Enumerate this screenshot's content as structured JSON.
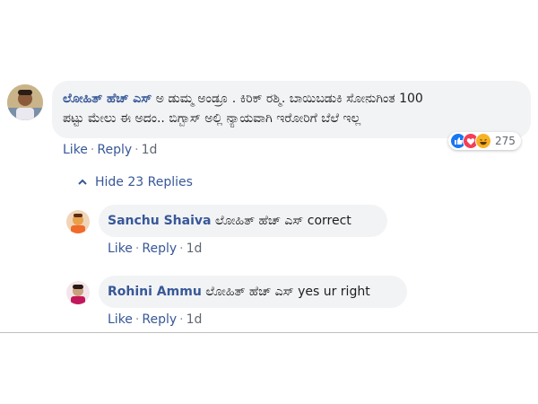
{
  "comments": [
    {
      "author": "ಲೋಹಿತ್ ಹೆಚ್ ಎಸ್",
      "text_line1": "ಅ ಡುಮ್ಮ ಅಂಡ್ರೂ . ಕಿರಿಕ್ ರಶ್ಮಿ. ಬಾಯಿಬಡುಕಿ ಸೋನುಗಿಂತ 100",
      "text_line2": "ಪಟ್ಟು ಮೇಲು ಈ ಅದಂ.. ಬಿಗ್ಬಾಸ್ ಅಲ್ಲಿ ನ್ಯಾಯವಾಗಿ ಇರೋರಿಗೆ ಬೆಲೆ ಇಲ್ಲ",
      "like": "Like",
      "reply": "Reply",
      "time": "1d",
      "reaction_count": "275"
    }
  ],
  "hide_replies": "Hide 23 Replies",
  "replies": [
    {
      "author": "Sanchu Shaiva",
      "text": "ಲೋಹಿತ್ ಹೆಚ್ ಎಸ್ correct",
      "like": "Like",
      "reply": "Reply",
      "time": "1d"
    },
    {
      "author": "Rohini Ammu",
      "text": "ಲೋಹಿತ್ ಹೆಚ್ ಎಸ್ yes ur right",
      "like": "Like",
      "reply": "Reply",
      "time": "1d"
    }
  ],
  "reaction_icons": [
    "like-icon",
    "love-icon",
    "haha-icon"
  ],
  "colors": {
    "author": "#385898",
    "bubble": "#f2f3f5",
    "like_blue": "#1877f2",
    "love_red": "#f33e58",
    "haha_yellow": "#f7b125"
  }
}
